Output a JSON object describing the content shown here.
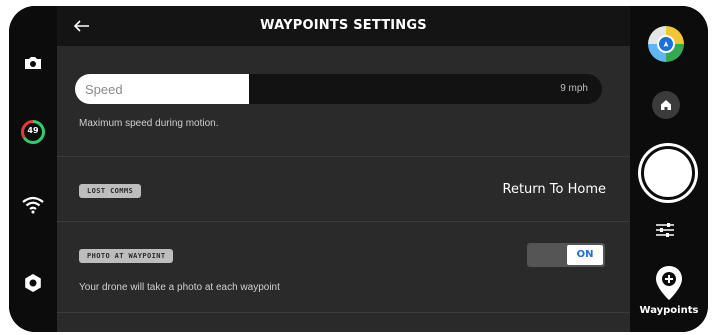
{
  "header": {
    "title": "WAYPOINTS SETTINGS",
    "back_icon": "arrow-left-icon"
  },
  "left_rail": {
    "camera_icon": "camera-icon",
    "battery": {
      "value": "49",
      "level_percent": 49,
      "ring_color": "#2ecc71",
      "ring_color_low": "#e03a3a"
    },
    "wifi_icon": "wifi-icon",
    "settings_icon": "gear-icon"
  },
  "speed": {
    "label": "Speed",
    "value": "9 mph",
    "fill_fraction": 0.33,
    "description": "Maximum speed during motion."
  },
  "lost_comms": {
    "tag": "LOST COMMS",
    "value": "Return To Home"
  },
  "photo_at_waypoint": {
    "tag": "PHOTO AT WAYPOINT",
    "toggle_label": "ON",
    "description": "Your drone will take a photo at each waypoint"
  },
  "right_rail": {
    "map_icon": "map-icon",
    "home_icon": "home-icon",
    "shutter": "shutter-button",
    "sliders_icon": "sliders-icon",
    "waypoints_label": "Waypoints",
    "waypoints_icon": "waypoint-pin-icon"
  },
  "colors": {
    "accent": "#1a6fe0",
    "panel": "#2a2a2a",
    "rail": "#0c0c0c"
  }
}
